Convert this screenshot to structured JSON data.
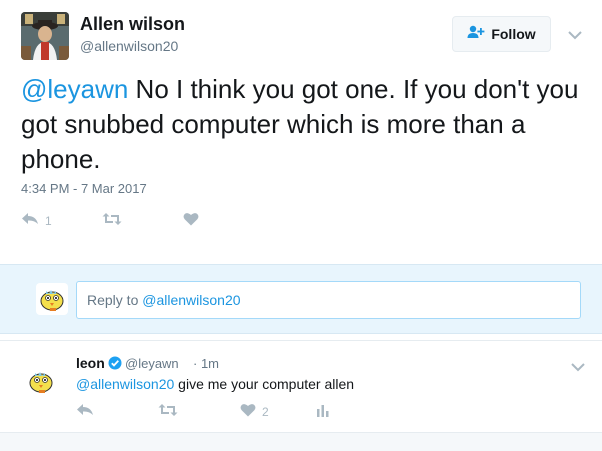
{
  "tweet": {
    "author_name": "Allen wilson",
    "author_handle": "@allenwilson20",
    "follow_label": "Follow",
    "text_mention": "@leyawn",
    "text_body": " No I think you got one. If you don't you got snubbed computer which is more than a phone.",
    "timestamp": "4:34 PM - 7 Mar 2017",
    "reply_count": "1",
    "retweet_count": "",
    "like_count": ""
  },
  "reply_box": {
    "prefix": "Reply to ",
    "handle": "@allenwilson20"
  },
  "reply": {
    "name": "leon",
    "handle": "@leyawn",
    "time": "· 1m",
    "mention": "@allenwilson20",
    "text": " give me your computer allen",
    "like_count": "2"
  },
  "colors": {
    "accent": "#1b95e0",
    "muted": "#657786",
    "icon": "#aab8c2",
    "reply_bg": "#e8f5fd"
  }
}
